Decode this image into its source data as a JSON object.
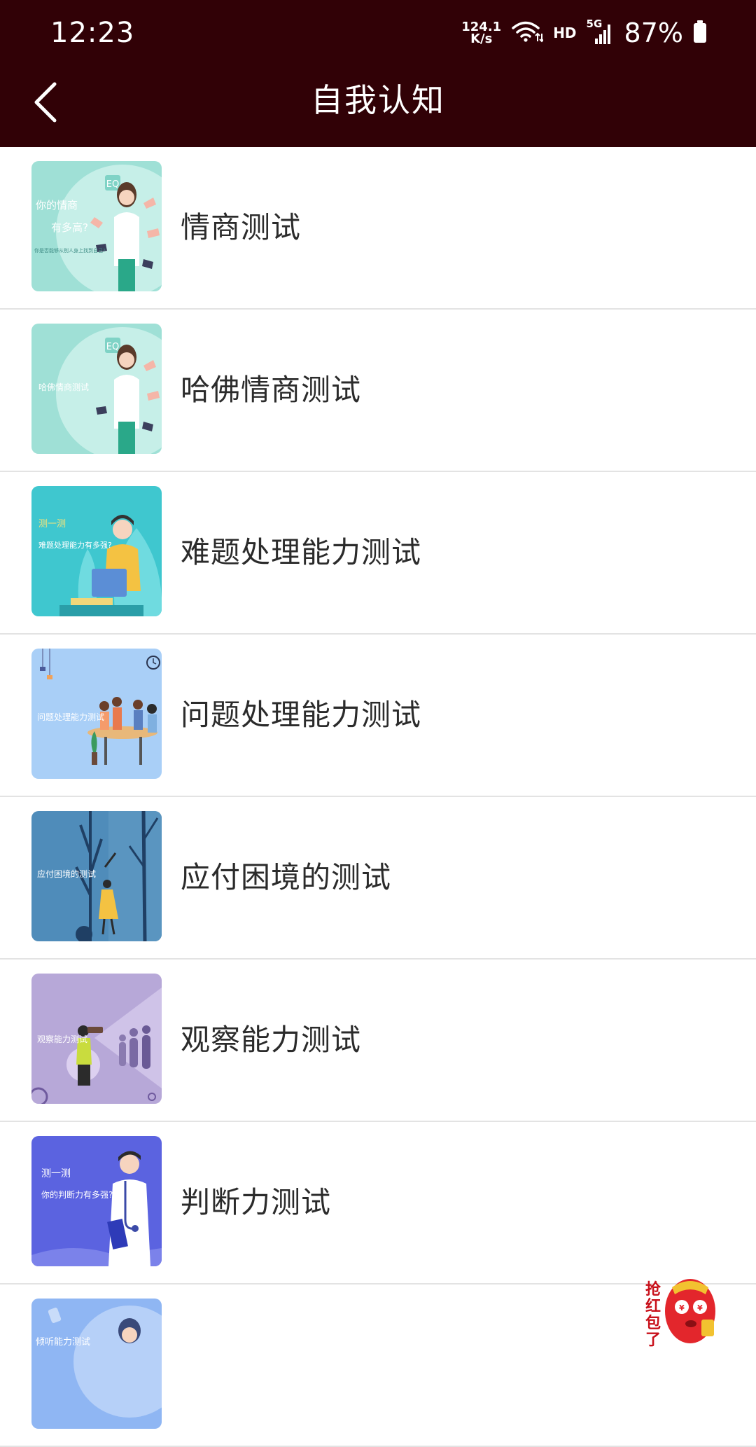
{
  "status_bar": {
    "time": "12:23",
    "net_speed_value": "124.1",
    "net_speed_unit": "K/s",
    "hd_label": "HD",
    "network_label": "5G",
    "battery_percent": "87%"
  },
  "app_bar": {
    "title": "自我认知"
  },
  "list": {
    "items": [
      {
        "label": "情商测试",
        "thumb_title": "你的情商",
        "thumb_title2": "有多高?",
        "thumb_sub": "你是否能够从别人身上找到自己?",
        "thumb_badge": "EQ"
      },
      {
        "label": "哈佛情商测试",
        "thumb_title": "哈佛情商测试",
        "thumb_badge": "EQ"
      },
      {
        "label": "难题处理能力测试",
        "thumb_title": "测一测",
        "thumb_title2": "难题处理能力有多强?"
      },
      {
        "label": "问题处理能力测试",
        "thumb_title": "问题处理能力测试"
      },
      {
        "label": "应付困境的测试",
        "thumb_title": "应付困境的测试"
      },
      {
        "label": "观察能力测试",
        "thumb_title": "观察能力测试"
      },
      {
        "label": "判断力测试",
        "thumb_title": "测一测",
        "thumb_title2": "你的判断力有多强?"
      },
      {
        "label": "",
        "thumb_title": "倾听能力测试"
      }
    ]
  },
  "floating": {
    "red_packet_text": "抢红包了"
  },
  "colors": {
    "header_bg": "#310106",
    "divider": "#e3e3e3",
    "text": "#2b2b2b"
  }
}
